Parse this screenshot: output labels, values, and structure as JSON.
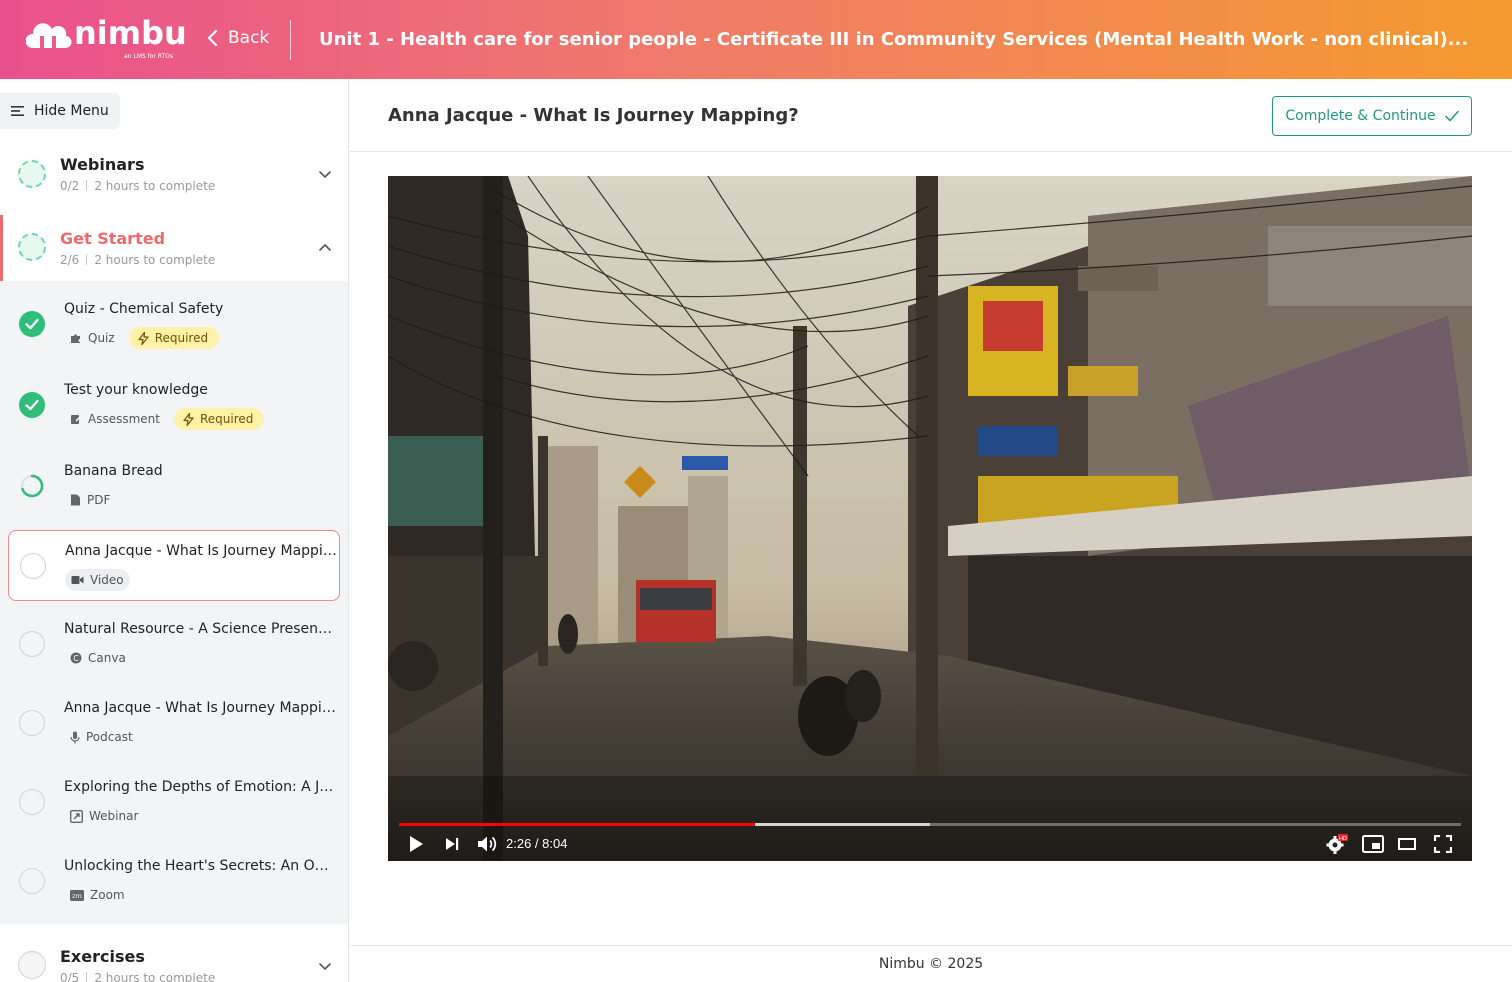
{
  "header": {
    "logo_text": "nimbu",
    "logo_tagline": "an LMS for RTOs",
    "back_label": "Back",
    "course_title": "Unit 1 - Health care for senior people - Certificate III in Community Services (Mental Health Work - non clinical)..."
  },
  "sidebar": {
    "hide_menu_label": "Hide Menu",
    "sections": [
      {
        "title": "Webinars",
        "progress": "0/2",
        "duration": "2 hours to complete",
        "expanded": false
      },
      {
        "title": "Get Started",
        "progress": "2/6",
        "duration": "2 hours to complete",
        "expanded": true
      },
      {
        "title": "Exercises",
        "progress": "0/5",
        "duration": "2 hours to complete",
        "expanded": false
      }
    ],
    "lessons": [
      {
        "title": "Quiz - Chemical Safety",
        "type": "Quiz",
        "type_icon": "puzzle-icon",
        "status": "completed",
        "required": "Required"
      },
      {
        "title": "Test your knowledge",
        "type": "Assessment",
        "type_icon": "edit-icon",
        "status": "completed",
        "required": "Required"
      },
      {
        "title": "Banana Bread",
        "type": "PDF",
        "type_icon": "document-icon",
        "status": "in-progress",
        "required": ""
      },
      {
        "title": "Anna Jacque - What Is Journey Mapping?",
        "type": "Video",
        "type_icon": "video-camera-icon",
        "status": "current",
        "required": ""
      },
      {
        "title": "Natural Resource - A Science Presentation",
        "type": "Canva",
        "type_icon": "canva-icon",
        "status": "not-started",
        "required": ""
      },
      {
        "title": "Anna Jacque - What Is Journey Mapping?",
        "type": "Podcast",
        "type_icon": "microphone-icon",
        "status": "not-started",
        "required": ""
      },
      {
        "title": "Exploring the Depths of Emotion: A Journey",
        "type": "Webinar",
        "type_icon": "webinar-icon",
        "status": "not-started",
        "required": ""
      },
      {
        "title": "Unlocking the Heart's Secrets: An Official Guide",
        "type": "Zoom",
        "type_icon": "zoom-icon",
        "status": "not-started",
        "required": ""
      }
    ]
  },
  "main": {
    "lesson_title": "Anna Jacque - What Is Journey Mapping?",
    "complete_button": "Complete & Continue",
    "video": {
      "current_time": "2:26",
      "duration": "8:04",
      "time_display": "2:26 / 8:04",
      "played_fraction": 0.335,
      "buffered_fraction": 0.5,
      "quality_badge": "HD"
    }
  },
  "footer": {
    "text": "Nimbu © 2025"
  },
  "colors": {
    "header_gradient_start": "#e9508e",
    "header_gradient_end": "#f59a2f",
    "accent_red": "#ee6b6b",
    "success_green": "#2fbe7a",
    "button_teal": "#1f9b75",
    "required_yellow": "#fff1a8"
  }
}
